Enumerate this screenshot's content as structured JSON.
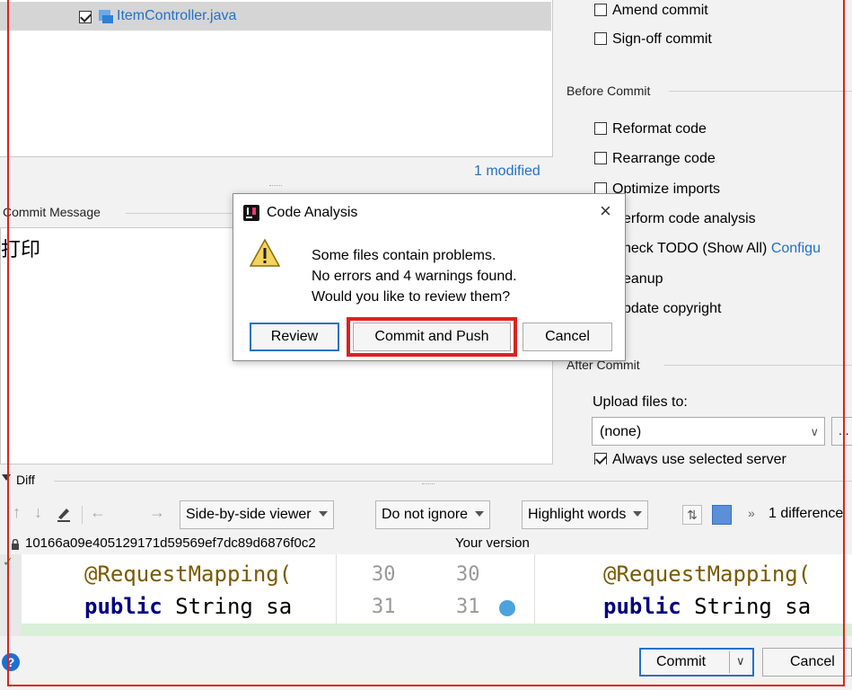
{
  "colors": {
    "accent": "#2470c8",
    "highlight": "#e02020",
    "link": "#2470c8",
    "dialog_bg": "#ffffff",
    "selected_row": "#d5d5d5"
  },
  "changes": {
    "file_name": "ItemController.java",
    "modified": "1 modified"
  },
  "commit": {
    "label": "Commit Message",
    "message": "打印"
  },
  "options": {
    "amend": "Amend commit",
    "signoff": "Sign-off commit",
    "before_title": "Before Commit",
    "reformat": "Reformat code",
    "rearrange": "Rearrange code",
    "optimize": "Optimize imports",
    "analysis": "erform code analysis",
    "todo": "heck TODO (Show All)",
    "configure": "Configu",
    "cleanup": "eanup",
    "copyright": "pdate copyright",
    "after_title": "After Commit",
    "upload_label": "Upload files to:",
    "upload_value": "(none)",
    "more": "...",
    "always": "Always use selected server"
  },
  "dialog": {
    "title": "Code Analysis",
    "line1": "Some files contain problems.",
    "line2": "No errors and 4 warnings found.",
    "line3": "Would you like to review them?",
    "review": "Review",
    "commit_push": "Commit and Push",
    "cancel": "Cancel",
    "close": "×"
  },
  "diff": {
    "title": "Diff",
    "viewer": "Side-by-side viewer",
    "ignore": "Do not ignore",
    "highlight": "Highlight words",
    "differences": "1 difference",
    "hash": "10166a09e405129171d59569ef7dc89d6876f0c2",
    "your_version": "Your version",
    "left_lines": [
      "@RequestMapping(",
      "public String sa"
    ],
    "right_lines": [
      "@RequestMapping(",
      "public String sa"
    ],
    "left_nums": [
      "30",
      "31"
    ],
    "right_nums": [
      "30",
      "31"
    ],
    "kw_public": "public",
    "rest": " String sa"
  },
  "footer": {
    "commit": "Commit",
    "cancel": "Cancel",
    "help": "?"
  }
}
